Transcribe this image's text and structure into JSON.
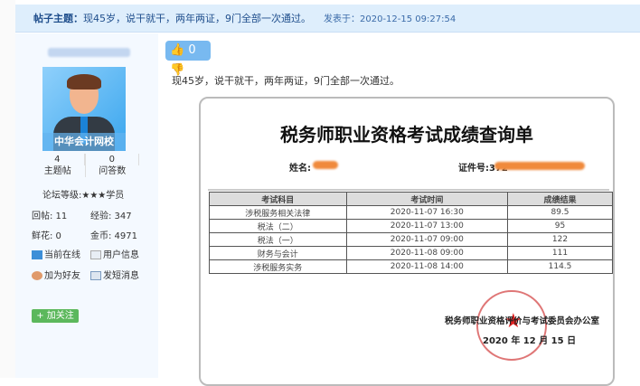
{
  "topic": {
    "label": "帖子主题：",
    "title": "现45岁，说干就干，两年两证，9门全部一次通过。",
    "posted": "发表于：2020-12-15 09:27:54"
  },
  "user": {
    "brand": "中华会计网校",
    "threads": "4",
    "threads_label": "主题帖",
    "answers": "0",
    "answers_label": "问答数",
    "level": "论坛等级:★★★学员",
    "replies": "回帖: 11",
    "exp": "经验: 347",
    "flowers": "鲜花: 0",
    "coins": "金币: 4971",
    "online": "当前在线",
    "info": "用户信息",
    "add_friend": "加为好友",
    "message": "发短消息",
    "follow": "+ 加关注"
  },
  "post": {
    "likes": "0",
    "text": "现45岁，说干就干，两年两证，9门全部一次通过。"
  },
  "cert": {
    "title": "税务师职业资格考试成绩查询单",
    "name_label": "姓名:",
    "id_label": "证件号:372",
    "headers": [
      "考试科目",
      "考试时间",
      "成绩结果"
    ],
    "rows": [
      [
        "涉税服务相关法律",
        "2020-11-07 16:30",
        "89.5"
      ],
      [
        "税法（二）",
        "2020-11-07 13:00",
        "95"
      ],
      [
        "税法（一）",
        "2020-11-07 09:00",
        "122"
      ],
      [
        "财务与会计",
        "2020-11-08 09:00",
        "111"
      ],
      [
        "涉税服务实务",
        "2020-11-08 14:00",
        "114.5"
      ]
    ],
    "office": "税务师职业资格评价与考试委员会办公室",
    "date": "2020 年 12 月 15 日"
  }
}
